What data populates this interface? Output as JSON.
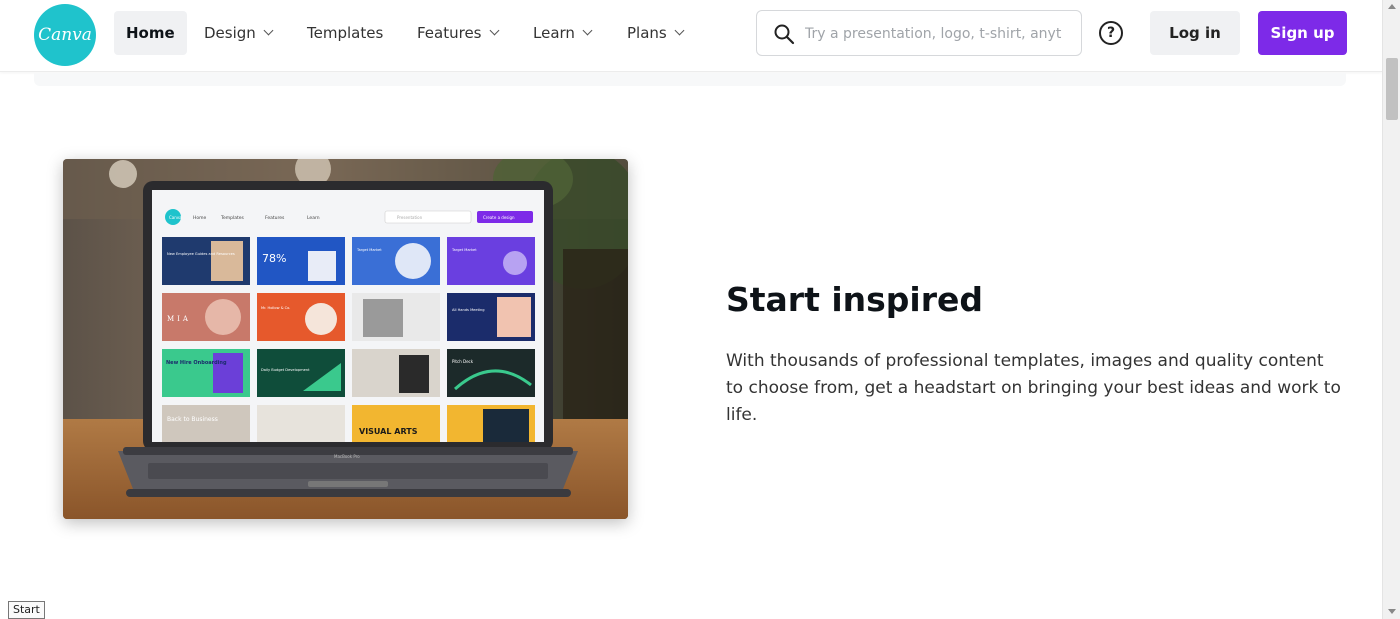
{
  "header": {
    "logo_text": "Canva",
    "nav": [
      {
        "label": "Home",
        "active": true
      },
      {
        "label": "Design"
      },
      {
        "label": "Templates"
      },
      {
        "label": "Features"
      },
      {
        "label": "Learn"
      },
      {
        "label": "Plans"
      }
    ],
    "search": {
      "placeholder": "Try a presentation, logo, t-shirt, anyt",
      "icon": "search-icon"
    },
    "help_glyph": "?",
    "login_label": "Log in",
    "signup_label": "Sign up"
  },
  "colors": {
    "brand_teal": "#1fc3cc",
    "signup_purple": "#7d2ae8"
  },
  "hero": {
    "headline": "Start inspired",
    "body": "With thousands of professional templates, images and quality content to choose from, get a headstart on bringing your best ideas and work to life.",
    "screen": {
      "logo_text": "Canva",
      "nav": [
        "Home",
        "Templates",
        "Features",
        "Learn"
      ],
      "search_placeholder": "Presentation",
      "create_button": "Create a design",
      "tiles": [
        "New Employee Guides and Resources",
        "78%",
        "Target Market",
        "Target Market",
        "MIA",
        "Mr. Hollow & Co.",
        "All Hands Meeting",
        "New Hire Onboarding",
        "Daily Budget Development",
        "Pitch Deck",
        "VISUAL ARTS",
        "Back to Business"
      ],
      "base_label": "MacBook Pro"
    }
  },
  "status_tip": "Start"
}
